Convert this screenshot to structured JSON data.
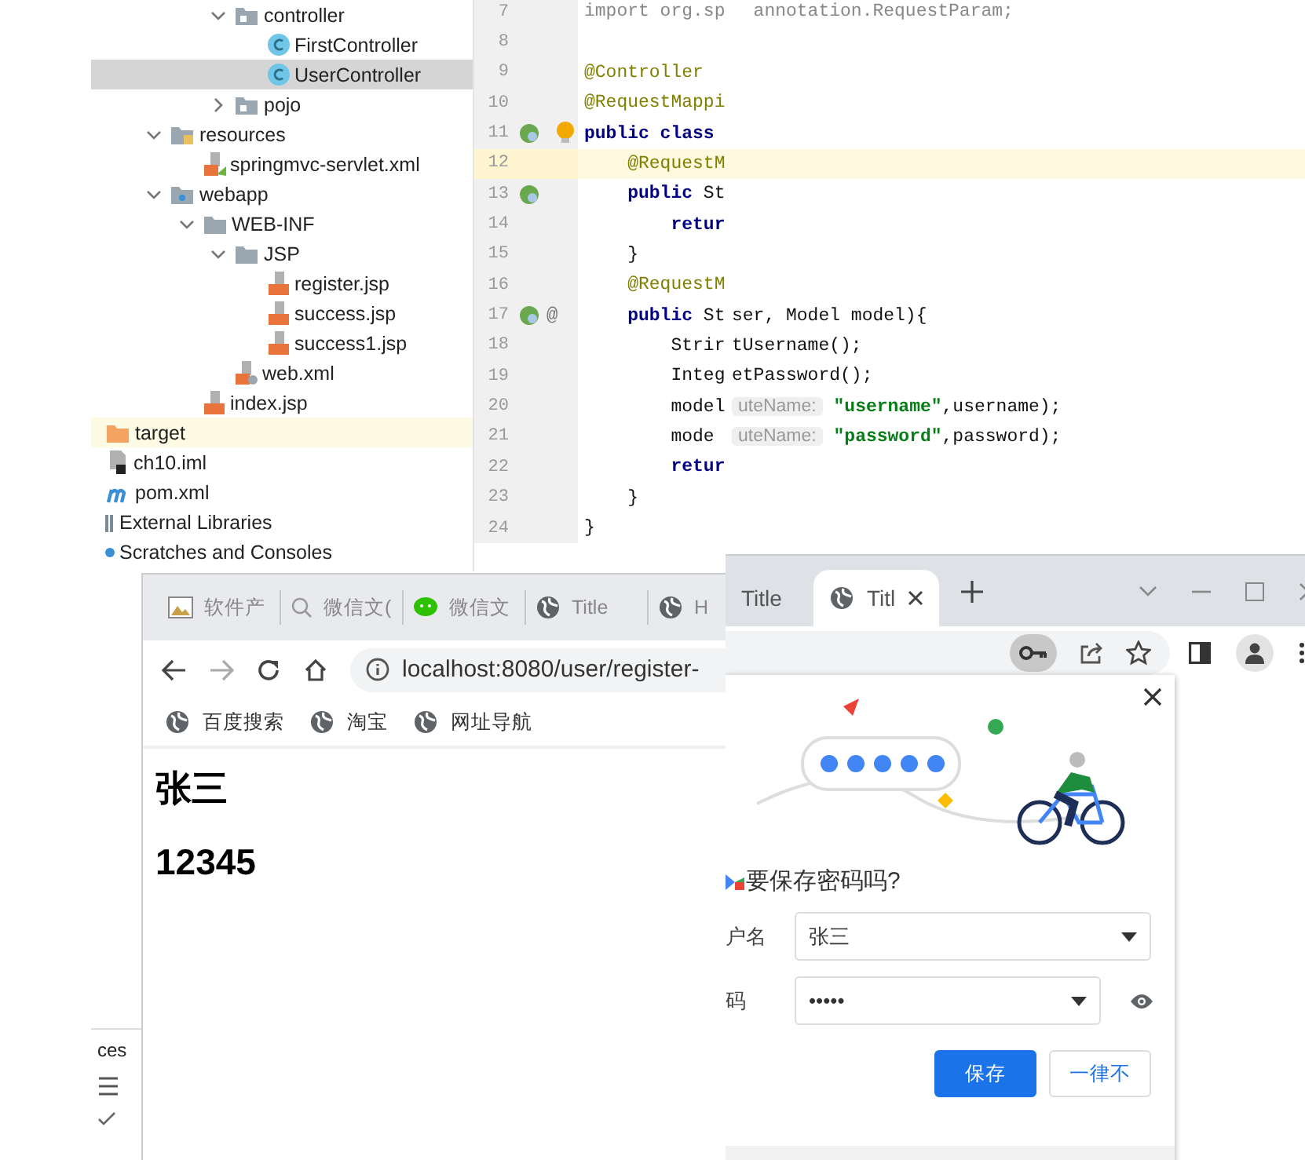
{
  "project_tree": {
    "cut_branch": [
      {
        "label": "controller",
        "kind": "package",
        "expanded": true,
        "selected": false,
        "children": [
          {
            "label": "FirstController",
            "kind": "class",
            "selected": false
          },
          {
            "label": "UserController",
            "kind": "class",
            "selected": true
          }
        ]
      },
      {
        "label": "pojo",
        "kind": "package",
        "expanded": false,
        "selected": false
      }
    ],
    "source_folders": [
      {
        "label": "resources",
        "kind": "resources-folder",
        "expanded": true,
        "selected": false,
        "children": [
          {
            "label": "springmvc-servlet.xml",
            "kind": "spring-xml",
            "selected": false
          }
        ]
      },
      {
        "label": "webapp",
        "kind": "web-folder",
        "expanded": true,
        "selected": false,
        "children": [
          {
            "label": "WEB-INF",
            "kind": "folder",
            "expanded": true,
            "selected": false,
            "children": [
              {
                "label": "JSP",
                "kind": "folder",
                "expanded": true,
                "selected": false,
                "children": [
                  {
                    "label": "register.jsp",
                    "kind": "jsp",
                    "selected": false
                  },
                  {
                    "label": "success.jsp",
                    "kind": "jsp",
                    "selected": false
                  },
                  {
                    "label": "success1.jsp",
                    "kind": "jsp",
                    "selected": false
                  }
                ]
              },
              {
                "label": "web.xml",
                "kind": "web-xml",
                "selected": false
              }
            ]
          },
          {
            "label": "index.jsp",
            "kind": "jsp",
            "selected": false
          }
        ]
      }
    ],
    "root_items": [
      {
        "label": "target",
        "kind": "excluded-folder",
        "selected": false
      },
      {
        "label": "ch10.iml",
        "kind": "iml",
        "selected": false
      },
      {
        "label": "pom.xml",
        "kind": "maven",
        "selected": false
      },
      {
        "label": "External Libraries",
        "kind": "library",
        "selected": false
      },
      {
        "label": "Scratches and Consoles",
        "kind": "scratches",
        "selected": false
      }
    ]
  },
  "editor": {
    "lines": [
      {
        "number": "7",
        "kind": "plain",
        "current": false,
        "bulb": false,
        "left": [
          {
            "kind": "import",
            "text": "import org.sp"
          }
        ],
        "right": [
          {
            "kind": "import",
            "text": "  annotation.RequestParam;"
          }
        ]
      },
      {
        "number": "8",
        "kind": "plain",
        "current": false,
        "bulb": false
      },
      {
        "number": "9",
        "kind": "plain",
        "current": false,
        "bulb": false,
        "left": [
          {
            "kind": "annotation",
            "text": "@Controller"
          }
        ]
      },
      {
        "number": "10",
        "kind": "plain",
        "current": false,
        "bulb": false,
        "left": [
          {
            "kind": "annotation",
            "text": "@RequestMappi"
          }
        ]
      },
      {
        "number": "11",
        "kind": "bean",
        "current": false,
        "bulb": true,
        "left": [
          {
            "kind": "keyword",
            "text": "public class"
          }
        ]
      },
      {
        "number": "12",
        "kind": "plain",
        "current": true,
        "bulb": false,
        "left": [
          {
            "kind": "annotation",
            "text": "    @RequestM"
          }
        ]
      },
      {
        "number": "13",
        "kind": "bean",
        "current": false,
        "bulb": false,
        "left": [
          {
            "kind": "keyword",
            "text": "    public "
          },
          {
            "kind": "plain",
            "text": "St"
          }
        ]
      },
      {
        "number": "14",
        "kind": "plain",
        "current": false,
        "bulb": false,
        "left": [
          {
            "kind": "keyword",
            "text": "        retur"
          }
        ]
      },
      {
        "number": "15",
        "kind": "plain",
        "current": false,
        "bulb": false,
        "left": [
          {
            "kind": "plain",
            "text": "    }"
          }
        ]
      },
      {
        "number": "16",
        "kind": "plain",
        "current": false,
        "bulb": false,
        "left": [
          {
            "kind": "annotation",
            "text": "    @RequestM"
          }
        ]
      },
      {
        "number": "17",
        "kind": "bean",
        "gutter_text": "@",
        "current": false,
        "bulb": false,
        "left": [
          {
            "kind": "keyword",
            "text": "    public "
          },
          {
            "kind": "plain",
            "text": "St"
          }
        ],
        "right": [
          {
            "kind": "plain",
            "text": "ser, Model model){"
          }
        ]
      },
      {
        "number": "18",
        "kind": "plain",
        "current": false,
        "bulb": false,
        "left": [
          {
            "kind": "plain",
            "text": "        Strir"
          }
        ],
        "right": [
          {
            "kind": "plain",
            "text": "tUsername();"
          }
        ]
      },
      {
        "number": "19",
        "kind": "plain",
        "current": false,
        "bulb": false,
        "left": [
          {
            "kind": "plain",
            "text": "        Integ"
          }
        ],
        "right": [
          {
            "kind": "plain",
            "text": "etPassword();"
          }
        ]
      },
      {
        "number": "20",
        "kind": "plain",
        "current": false,
        "bulb": false,
        "left": [
          {
            "kind": "plain",
            "text": "        model"
          }
        ],
        "right": [
          {
            "kind": "hint",
            "text": "uteName:"
          },
          {
            "kind": "string",
            "text": " \"username\""
          },
          {
            "kind": "plain",
            "text": ",username);"
          }
        ]
      },
      {
        "number": "21",
        "kind": "plain",
        "current": false,
        "bulb": false,
        "left": [
          {
            "kind": "plain",
            "text": "        mode"
          }
        ],
        "right": [
          {
            "kind": "hint",
            "text": "uteName:"
          },
          {
            "kind": "string",
            "text": " \"password\""
          },
          {
            "kind": "plain",
            "text": ",password);"
          }
        ]
      },
      {
        "number": "22",
        "kind": "plain",
        "current": false,
        "bulb": false,
        "left": [
          {
            "kind": "keyword",
            "text": "        retur"
          }
        ]
      },
      {
        "number": "23",
        "kind": "plain",
        "current": false,
        "bulb": false,
        "left": [
          {
            "kind": "plain",
            "text": "    }"
          }
        ]
      },
      {
        "number": "24",
        "kind": "plain",
        "current": false,
        "bulb": false,
        "left": [
          {
            "kind": "plain",
            "text": "}"
          }
        ]
      }
    ]
  },
  "tool_window": {
    "title": "ces"
  },
  "browser_left": {
    "tabs": [
      {
        "label": "软件产",
        "kind": "image",
        "selected": false
      },
      {
        "label": "微信文(",
        "kind": "search",
        "selected": false
      },
      {
        "label": "微信文",
        "kind": "chat",
        "selected": false
      },
      {
        "label": "Title",
        "kind": "globe",
        "selected": false
      },
      {
        "label": "H",
        "kind": "globe",
        "selected": false
      }
    ],
    "address": "localhost:8080/user/register-",
    "bookmarks": [
      "百度搜索",
      "淘宝",
      "网址导航"
    ],
    "content": [
      "张三",
      "12345"
    ]
  },
  "browser_right": {
    "tabs": [
      {
        "label": "Title",
        "selected": false
      },
      {
        "label": "Titl",
        "selected": true
      }
    ],
    "dialog": {
      "title": "要保存密码吗?",
      "username_label": "户名",
      "username": "张三",
      "password_label": "码",
      "password": "•••••",
      "buttons": [
        {
          "label": "保存",
          "kind": "primary"
        },
        {
          "label": "一律不",
          "kind": "secondary"
        }
      ]
    }
  }
}
